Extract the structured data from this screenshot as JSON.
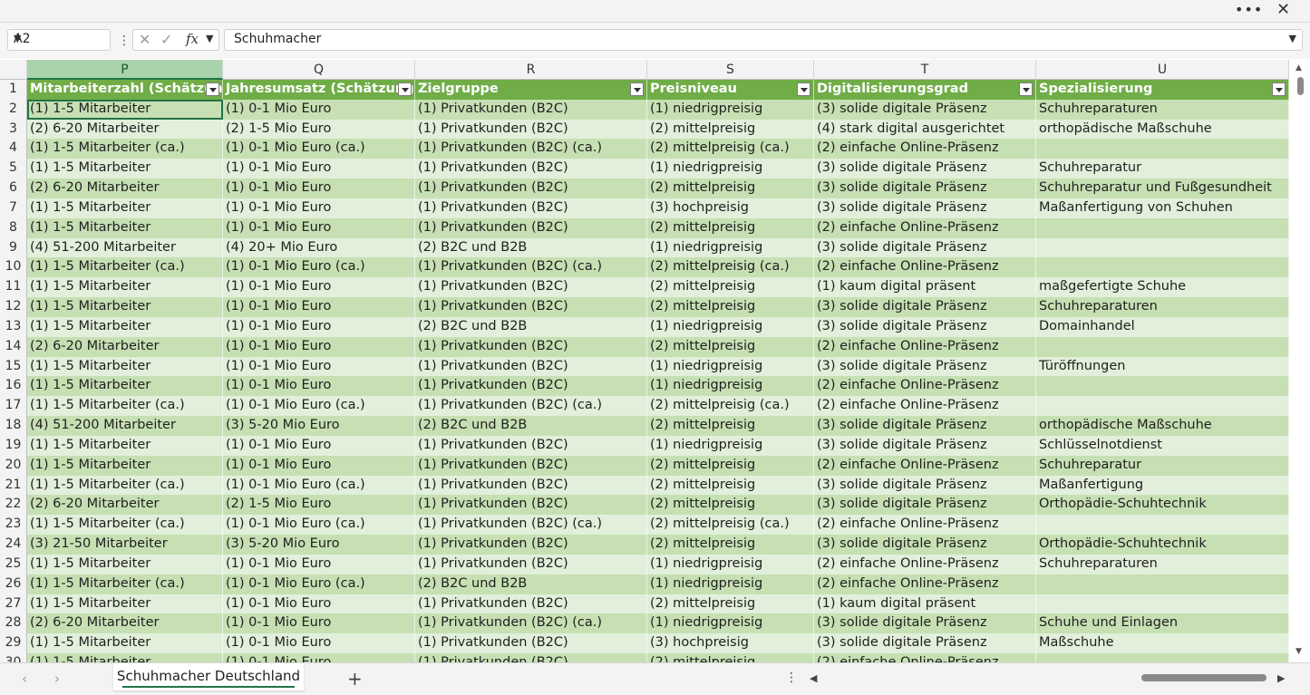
{
  "window": {
    "more_label": "•••",
    "close_label": "✕"
  },
  "formula_bar": {
    "name_box": "A2",
    "formula": "Schuhmacher",
    "fx_label": "fx",
    "cancel_glyph": "✕",
    "enter_glyph": "✓",
    "separator": "⋮"
  },
  "columns": [
    {
      "letter": "P",
      "header": "Mitarbeiterzahl (Schätzung)",
      "selected": true
    },
    {
      "letter": "Q",
      "header": "Jahresumsatz (Schätzung)"
    },
    {
      "letter": "R",
      "header": "Zielgruppe"
    },
    {
      "letter": "S",
      "header": "Preisniveau"
    },
    {
      "letter": "T",
      "header": "Digitalisierungsgrad"
    },
    {
      "letter": "U",
      "header": "Spezialisierung"
    }
  ],
  "rows": [
    {
      "num": "2",
      "cells": [
        "(1) 1-5 Mitarbeiter",
        "(1) 0-1 Mio Euro",
        "(1) Privatkunden (B2C)",
        "(1) niedrigpreisig",
        "(3) solide digitale Präsenz",
        "Schuhreparaturen"
      ]
    },
    {
      "num": "3",
      "cells": [
        "(2) 6-20 Mitarbeiter",
        "(2) 1-5 Mio Euro",
        "(1) Privatkunden (B2C)",
        "(2) mittelpreisig",
        "(4) stark digital ausgerichtet",
        "orthopädische Maßschuhe"
      ]
    },
    {
      "num": "4",
      "cells": [
        "(1) 1-5 Mitarbeiter (ca.)",
        "(1) 0-1 Mio Euro (ca.)",
        "(1) Privatkunden (B2C) (ca.)",
        "(2) mittelpreisig (ca.)",
        "(2) einfache Online-Präsenz",
        ""
      ]
    },
    {
      "num": "5",
      "cells": [
        "(1) 1-5 Mitarbeiter",
        "(1) 0-1 Mio Euro",
        "(1) Privatkunden (B2C)",
        "(1) niedrigpreisig",
        "(3) solide digitale Präsenz",
        "Schuhreparatur"
      ]
    },
    {
      "num": "6",
      "cells": [
        "(2) 6-20 Mitarbeiter",
        "(1) 0-1 Mio Euro",
        "(1) Privatkunden (B2C)",
        "(2) mittelpreisig",
        "(3) solide digitale Präsenz",
        "Schuhreparatur und Fußgesundheit"
      ]
    },
    {
      "num": "7",
      "cells": [
        "(1) 1-5 Mitarbeiter",
        "(1) 0-1 Mio Euro",
        "(1) Privatkunden (B2C)",
        "(3) hochpreisig",
        "(3) solide digitale Präsenz",
        "Maßanfertigung von Schuhen"
      ]
    },
    {
      "num": "8",
      "cells": [
        "(1) 1-5 Mitarbeiter",
        "(1) 0-1 Mio Euro",
        "(1) Privatkunden (B2C)",
        "(2) mittelpreisig",
        "(2) einfache Online-Präsenz",
        ""
      ]
    },
    {
      "num": "9",
      "cells": [
        "(4) 51-200 Mitarbeiter",
        "(4) 20+ Mio Euro",
        "(2) B2C und B2B",
        "(1) niedrigpreisig",
        "(3) solide digitale Präsenz",
        ""
      ]
    },
    {
      "num": "10",
      "cells": [
        "(1) 1-5 Mitarbeiter (ca.)",
        "(1) 0-1 Mio Euro (ca.)",
        "(1) Privatkunden (B2C) (ca.)",
        "(2) mittelpreisig (ca.)",
        "(2) einfache Online-Präsenz",
        ""
      ]
    },
    {
      "num": "11",
      "cells": [
        "(1) 1-5 Mitarbeiter",
        "(1) 0-1 Mio Euro",
        "(1) Privatkunden (B2C)",
        "(2) mittelpreisig",
        "(1) kaum digital präsent",
        "maßgefertigte Schuhe"
      ]
    },
    {
      "num": "12",
      "cells": [
        "(1) 1-5 Mitarbeiter",
        "(1) 0-1 Mio Euro",
        "(1) Privatkunden (B2C)",
        "(2) mittelpreisig",
        "(3) solide digitale Präsenz",
        "Schuhreparaturen"
      ]
    },
    {
      "num": "13",
      "cells": [
        "(1) 1-5 Mitarbeiter",
        "(1) 0-1 Mio Euro",
        "(2) B2C und B2B",
        "(1) niedrigpreisig",
        "(3) solide digitale Präsenz",
        "Domainhandel"
      ]
    },
    {
      "num": "14",
      "cells": [
        "(2) 6-20 Mitarbeiter",
        "(1) 0-1 Mio Euro",
        "(1) Privatkunden (B2C)",
        "(2) mittelpreisig",
        "(2) einfache Online-Präsenz",
        ""
      ]
    },
    {
      "num": "15",
      "cells": [
        "(1) 1-5 Mitarbeiter",
        "(1) 0-1 Mio Euro",
        "(1) Privatkunden (B2C)",
        "(1) niedrigpreisig",
        "(3) solide digitale Präsenz",
        "Türöffnungen"
      ]
    },
    {
      "num": "16",
      "cells": [
        "(1) 1-5 Mitarbeiter",
        "(1) 0-1 Mio Euro",
        "(1) Privatkunden (B2C)",
        "(1) niedrigpreisig",
        "(2) einfache Online-Präsenz",
        ""
      ]
    },
    {
      "num": "17",
      "cells": [
        "(1) 1-5 Mitarbeiter (ca.)",
        "(1) 0-1 Mio Euro (ca.)",
        "(1) Privatkunden (B2C) (ca.)",
        "(2) mittelpreisig (ca.)",
        "(2) einfache Online-Präsenz",
        ""
      ]
    },
    {
      "num": "18",
      "cells": [
        "(4) 51-200 Mitarbeiter",
        "(3) 5-20 Mio Euro",
        "(2) B2C und B2B",
        "(2) mittelpreisig",
        "(3) solide digitale Präsenz",
        "orthopädische Maßschuhe"
      ]
    },
    {
      "num": "19",
      "cells": [
        "(1) 1-5 Mitarbeiter",
        "(1) 0-1 Mio Euro",
        "(1) Privatkunden (B2C)",
        "(1) niedrigpreisig",
        "(3) solide digitale Präsenz",
        "Schlüsselnotdienst"
      ]
    },
    {
      "num": "20",
      "cells": [
        "(1) 1-5 Mitarbeiter",
        "(1) 0-1 Mio Euro",
        "(1) Privatkunden (B2C)",
        "(2) mittelpreisig",
        "(2) einfache Online-Präsenz",
        "Schuhreparatur"
      ]
    },
    {
      "num": "21",
      "cells": [
        "(1) 1-5 Mitarbeiter (ca.)",
        "(1) 0-1 Mio Euro (ca.)",
        "(1) Privatkunden (B2C)",
        "(2) mittelpreisig",
        "(3) solide digitale Präsenz",
        "Maßanfertigung"
      ]
    },
    {
      "num": "22",
      "cells": [
        "(2) 6-20 Mitarbeiter",
        "(2) 1-5 Mio Euro",
        "(1) Privatkunden (B2C)",
        "(2) mittelpreisig",
        "(3) solide digitale Präsenz",
        "Orthopädie-Schuhtechnik"
      ]
    },
    {
      "num": "23",
      "cells": [
        "(1) 1-5 Mitarbeiter (ca.)",
        "(1) 0-1 Mio Euro (ca.)",
        "(1) Privatkunden (B2C) (ca.)",
        "(2) mittelpreisig (ca.)",
        "(2) einfache Online-Präsenz",
        ""
      ]
    },
    {
      "num": "24",
      "cells": [
        "(3) 21-50 Mitarbeiter",
        "(3) 5-20 Mio Euro",
        "(1) Privatkunden (B2C)",
        "(2) mittelpreisig",
        "(3) solide digitale Präsenz",
        "Orthopädie-Schuhtechnik"
      ]
    },
    {
      "num": "25",
      "cells": [
        "(1) 1-5 Mitarbeiter",
        "(1) 0-1 Mio Euro",
        "(1) Privatkunden (B2C)",
        "(1) niedrigpreisig",
        "(2) einfache Online-Präsenz",
        "Schuhreparaturen"
      ]
    },
    {
      "num": "26",
      "cells": [
        "(1) 1-5 Mitarbeiter (ca.)",
        "(1) 0-1 Mio Euro (ca.)",
        "(2) B2C und B2B",
        "(1) niedrigpreisig",
        "(2) einfache Online-Präsenz",
        ""
      ]
    },
    {
      "num": "27",
      "cells": [
        "(1) 1-5 Mitarbeiter",
        "(1) 0-1 Mio Euro",
        "(1) Privatkunden (B2C)",
        "(2) mittelpreisig",
        "(1) kaum digital präsent",
        ""
      ]
    },
    {
      "num": "28",
      "cells": [
        "(2) 6-20 Mitarbeiter",
        "(1) 0-1 Mio Euro",
        "(1) Privatkunden (B2C) (ca.)",
        "(1) niedrigpreisig",
        "(3) solide digitale Präsenz",
        "Schuhe und Einlagen"
      ]
    },
    {
      "num": "29",
      "cells": [
        "(1) 1-5 Mitarbeiter",
        "(1) 0-1 Mio Euro",
        "(1) Privatkunden (B2C)",
        "(3) hochpreisig",
        "(3) solide digitale Präsenz",
        "Maßschuhe"
      ]
    },
    {
      "num": "30",
      "cells": [
        "(1) 1-5 Mitarbeiter",
        "(1) 0-1 Mio Euro",
        "(1) Privatkunden (B2C)",
        "(2) mittelpreisig",
        "(2) einfache Online-Präsenz",
        ""
      ]
    }
  ],
  "sheet_tabs": {
    "active": "Schuhmacher Deutschland",
    "add_label": "+",
    "more_label": "⋮"
  },
  "colors": {
    "header_green": "#70ad47",
    "band_dark": "#c6e0b4",
    "band_light": "#e2efda",
    "accent": "#217346"
  }
}
